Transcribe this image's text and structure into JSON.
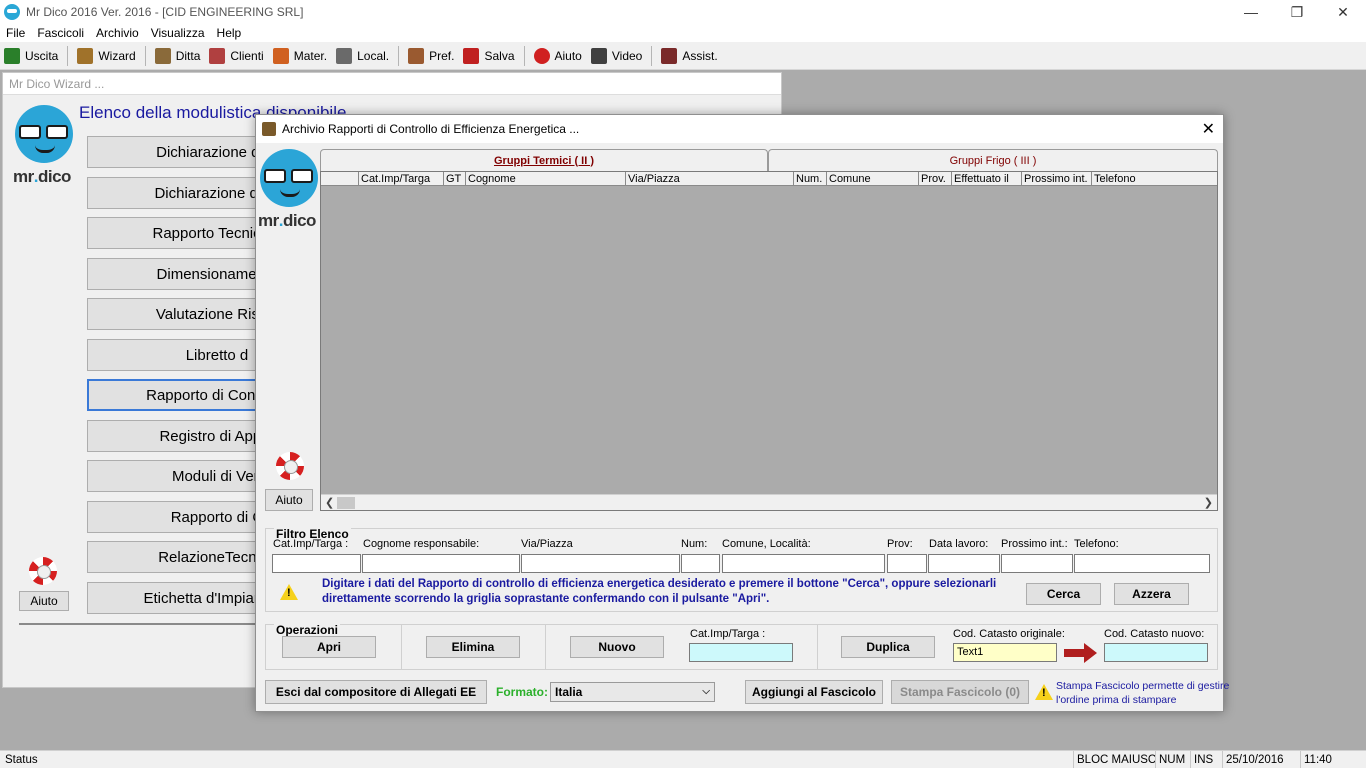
{
  "window": {
    "title": "Mr Dico 2016 Ver. 2016  -  [CID ENGINEERING SRL]"
  },
  "menu": [
    "File",
    "Fascicoli",
    "Archivio",
    "Visualizza",
    "Help"
  ],
  "toolbar": [
    {
      "label": "Uscita",
      "icon": "exit-icon",
      "color": "#2a7f2a"
    },
    {
      "label": "Wizard",
      "icon": "wizard-icon",
      "color": "#a0722a"
    },
    {
      "label": "Ditta",
      "icon": "company-icon",
      "color": "#8a6a3a"
    },
    {
      "label": "Clienti",
      "icon": "clients-icon",
      "color": "#b04040"
    },
    {
      "label": "Mater.",
      "icon": "materials-icon",
      "color": "#d06020"
    },
    {
      "label": "Local.",
      "icon": "location-icon",
      "color": "#6a6a6a"
    },
    {
      "label": "Pref.",
      "icon": "preferences-icon",
      "color": "#9a5a30"
    },
    {
      "label": "Salva",
      "icon": "save-icon",
      "color": "#c02020"
    },
    {
      "label": "Aiuto",
      "icon": "help-icon",
      "color": "#d02020"
    },
    {
      "label": "Video",
      "icon": "video-icon",
      "color": "#404040"
    },
    {
      "label": "Assist.",
      "icon": "assist-icon",
      "color": "#7a2a2a"
    }
  ],
  "wizard": {
    "title": "Mr Dico Wizard ...",
    "heading": "Elenco della modulistica disponibile",
    "logo_text_a": "mr",
    "logo_text_b": ".",
    "logo_text_c": "dico",
    "buttons": [
      "Dichiarazione di C",
      "Dichiarazione di Ri",
      "Rapporto Tecnico d",
      "Dimensionamento",
      "Valutazione Rischi",
      "Libretto d",
      "Rapporto di Controllo",
      "Registro di Appar",
      "Moduli di Veri",
      "Rapporto di C",
      "RelazioneTecnica",
      "Etichetta d'Impianto di"
    ],
    "help_label": "Aiuto"
  },
  "dialog": {
    "title": "Archivio Rapporti di Controllo di Efficienza Energetica ...",
    "help_label": "Aiuto",
    "tabs": [
      "Gruppi Termici ( II )",
      "Gruppi Frigo ( III )"
    ],
    "columns": [
      "",
      "Cat.Imp/Targa",
      "GT",
      "Cognome",
      "Via/Piazza",
      "Num.",
      "Comune",
      "Prov.",
      "Effettuato il",
      "Prossimo int.",
      "Telefono"
    ],
    "filter": {
      "title": "Filtro Elenco",
      "labels": [
        "Cat.Imp/Targa :",
        "Cognome responsabile:",
        "Via/Piazza",
        "Num:",
        "Comune, Località:",
        "Prov:",
        "Data lavoro:",
        "Prossimo int.:",
        "Telefono:"
      ],
      "hint_line1": "Digitare i dati del Rapporto di controllo di efficienza energetica desiderato e premere il bottone \"Cerca\", oppure selezionarli",
      "hint_line2": "direttamente scorrendo la griglia soprastante confermando con il pulsante \"Apri\".",
      "search_label": "Cerca",
      "reset_label": "Azzera"
    },
    "operations": {
      "title": "Operazioni",
      "open_label": "Apri",
      "delete_label": "Elimina",
      "new_label": "Nuovo",
      "plate_label": "Cat.Imp/Targa :",
      "plate_value": "",
      "duplicate_label": "Duplica",
      "orig_cadastre_label": "Cod. Catasto originale:",
      "orig_cadastre_value": "Text1",
      "new_cadastre_label": "Cod. Catasto nuovo:",
      "new_cadastre_value": ""
    },
    "footer": {
      "exit_label": "Esci dal compositore di Allegati EE",
      "format_label": "Formato:",
      "format_value": "Italia",
      "add_label": "Aggiungi al Fascicolo",
      "print_label": "Stampa Fascicolo (0)",
      "note_line1": "Stampa Fascicolo permette di gestire",
      "note_line2": "l'ordine prima di stampare"
    }
  },
  "status": {
    "text": "Status",
    "caps": "BLOC MAIUSC",
    "num": "NUM",
    "ins": "INS",
    "date": "25/10/2016",
    "time": "11:40"
  },
  "colors": {
    "accent": "#1a1aa0",
    "tab_text": "#800000",
    "highlight_input": "#cdf9fb",
    "yellow_input": "#ffffc8",
    "arrow": "#b01e1e"
  }
}
